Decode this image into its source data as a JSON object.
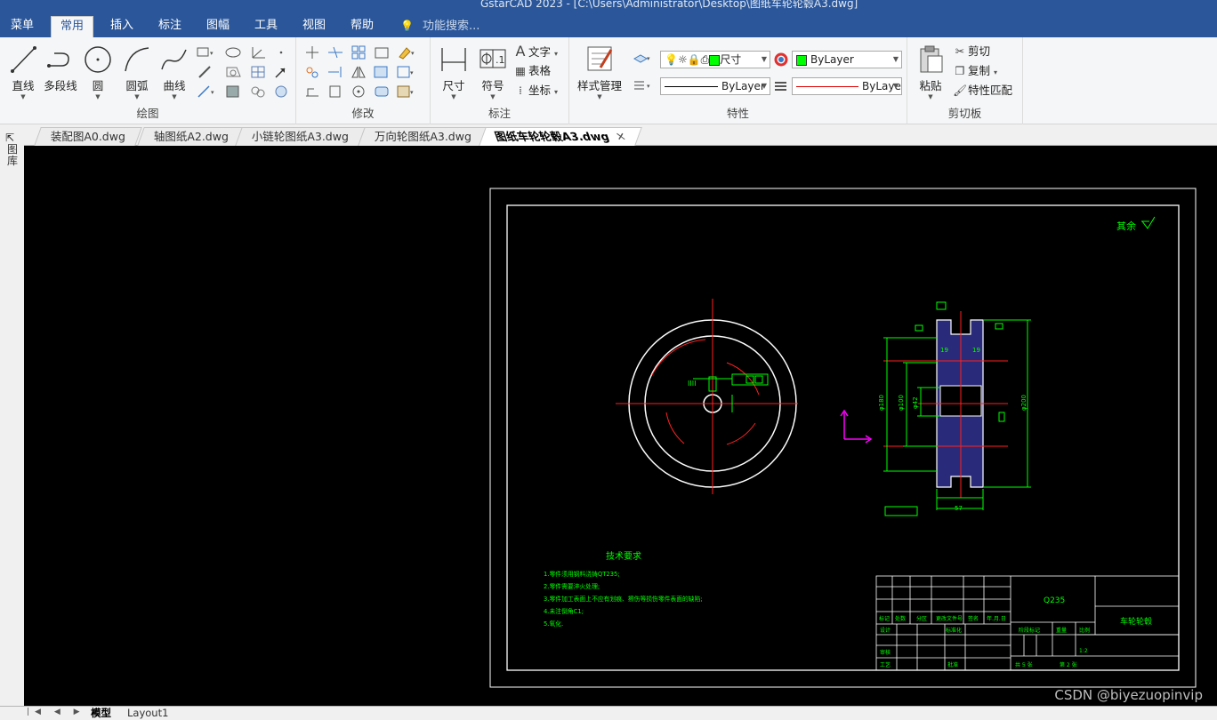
{
  "window": {
    "title": "GstarCAD 2023 - [C:\\Users\\Administrator\\Desktop\\图纸车轮轮毂A3.dwg]"
  },
  "menu_tabs": [
    "菜单",
    "常用",
    "插入",
    "标注",
    "图幅",
    "工具",
    "视图",
    "帮助"
  ],
  "active_tab": "常用",
  "search_placeholder": "功能搜索...",
  "ribbon": {
    "draw": {
      "label": "绘图",
      "line": "直线",
      "polyline": "多段线",
      "circle": "圆",
      "arc": "圆弧",
      "curve": "曲线"
    },
    "modify": {
      "label": "修改"
    },
    "annotate": {
      "label": "标注",
      "dimension": "尺寸",
      "symbol": "符号",
      "text": "文字",
      "table": "表格",
      "coordinate": "坐标"
    },
    "style": {
      "label": "样式管理"
    },
    "properties": {
      "label": "特性",
      "layer_value": "尺寸",
      "color_value": "ByLayer",
      "linetype_value": "ByLayer",
      "lineweight_value": "ByLayer",
      "layer_color": "#00ff00"
    },
    "clipboard": {
      "label": "剪切板",
      "paste": "粘贴",
      "cut": "剪切",
      "copy": "复制",
      "match": "特性匹配"
    }
  },
  "document_tabs": [
    {
      "name": "装配图A0.dwg"
    },
    {
      "name": "轴图纸A2.dwg"
    },
    {
      "name": "小链轮图纸A3.dwg"
    },
    {
      "name": "万向轮图纸A3.dwg"
    },
    {
      "name": "图纸车轮轮毂A3.dwg",
      "active": true
    }
  ],
  "sidebar_label": "图库",
  "drawing": {
    "roughness_note": "其余",
    "tech_title": "技术要求",
    "tech_lines": [
      "1.零件须用钢料浇铸QT235;",
      "2.零件需要淬火处理;",
      "3.零件加工表面上不应有划痕、擦伤等损伤零件表面的缺陷;",
      "4.未注倒角C1;",
      "5.氧化."
    ],
    "material": "Q235",
    "part_name": "车轮轮毂",
    "scale": "1:2",
    "sheet_total": "共 5 张",
    "sheet_no": "第 2 张",
    "tb_headers": [
      "标记",
      "处数",
      "分区",
      "更改文件号",
      "签名",
      "年.月.日"
    ],
    "tb_design": "设计",
    "tb_standard": "标准化",
    "tb_stage": "阶段标记",
    "tb_weight": "重量",
    "tb_scale": "比例",
    "tb_review": "审核",
    "tb_process": "工艺",
    "tb_approve": "批准",
    "dims": {
      "d1": "φ180",
      "d2": "φ100",
      "d3": "φ42",
      "d4": "φ200",
      "w": "57",
      "r1": "19",
      "r2": "19"
    },
    "colors": {
      "white": "#ffffff",
      "green": "#00ff00",
      "red": "#ff0000",
      "magenta": "#ff00ff",
      "hatch": "#2a2a7a"
    }
  },
  "layout_tabs": [
    "模型",
    "Layout1"
  ],
  "active_layout": "模型",
  "watermark": "CSDN @biyezuopinvip"
}
